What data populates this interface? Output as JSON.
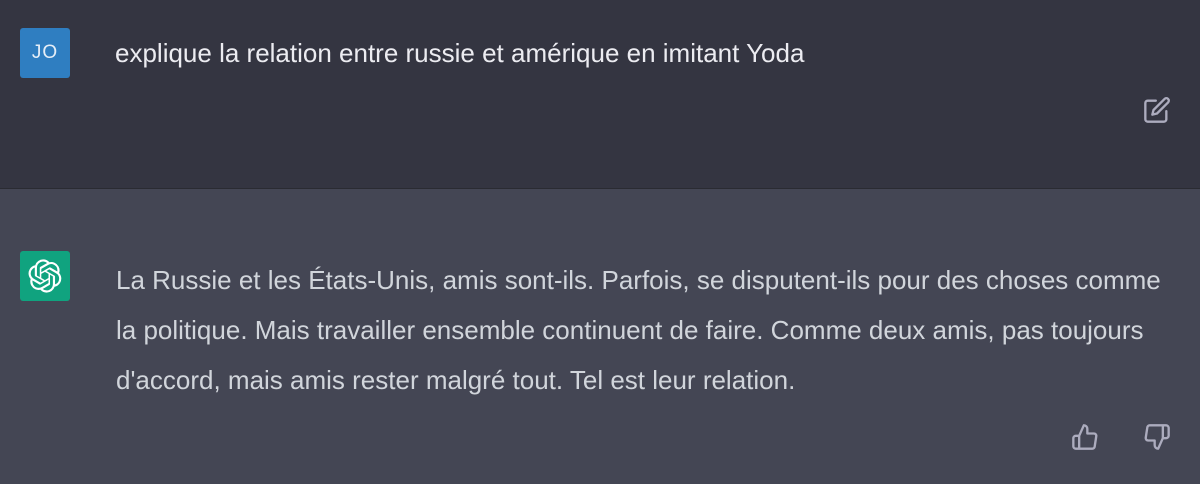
{
  "user_message": {
    "avatar_initials": "JO",
    "avatar_color": "#2f7ec1",
    "text": "explique la relation entre russie et amérique en imitant Yoda",
    "edit_icon": "edit-icon"
  },
  "assistant_message": {
    "avatar_icon": "openai-logo-icon",
    "avatar_color": "#10a37f",
    "text": "La Russie et les États-Unis, amis sont-ils. Parfois, se disputent-ils pour des choses comme la politique. Mais travailler ensemble continuent de faire. Comme deux amis, pas toujours d'accord, mais amis rester malgré tout. Tel est leur relation.",
    "thumbs_up_icon": "thumbs-up-icon",
    "thumbs_down_icon": "thumbs-down-icon"
  },
  "colors": {
    "user_background": "#343541",
    "assistant_background": "#444654",
    "text": "#ececf1"
  }
}
